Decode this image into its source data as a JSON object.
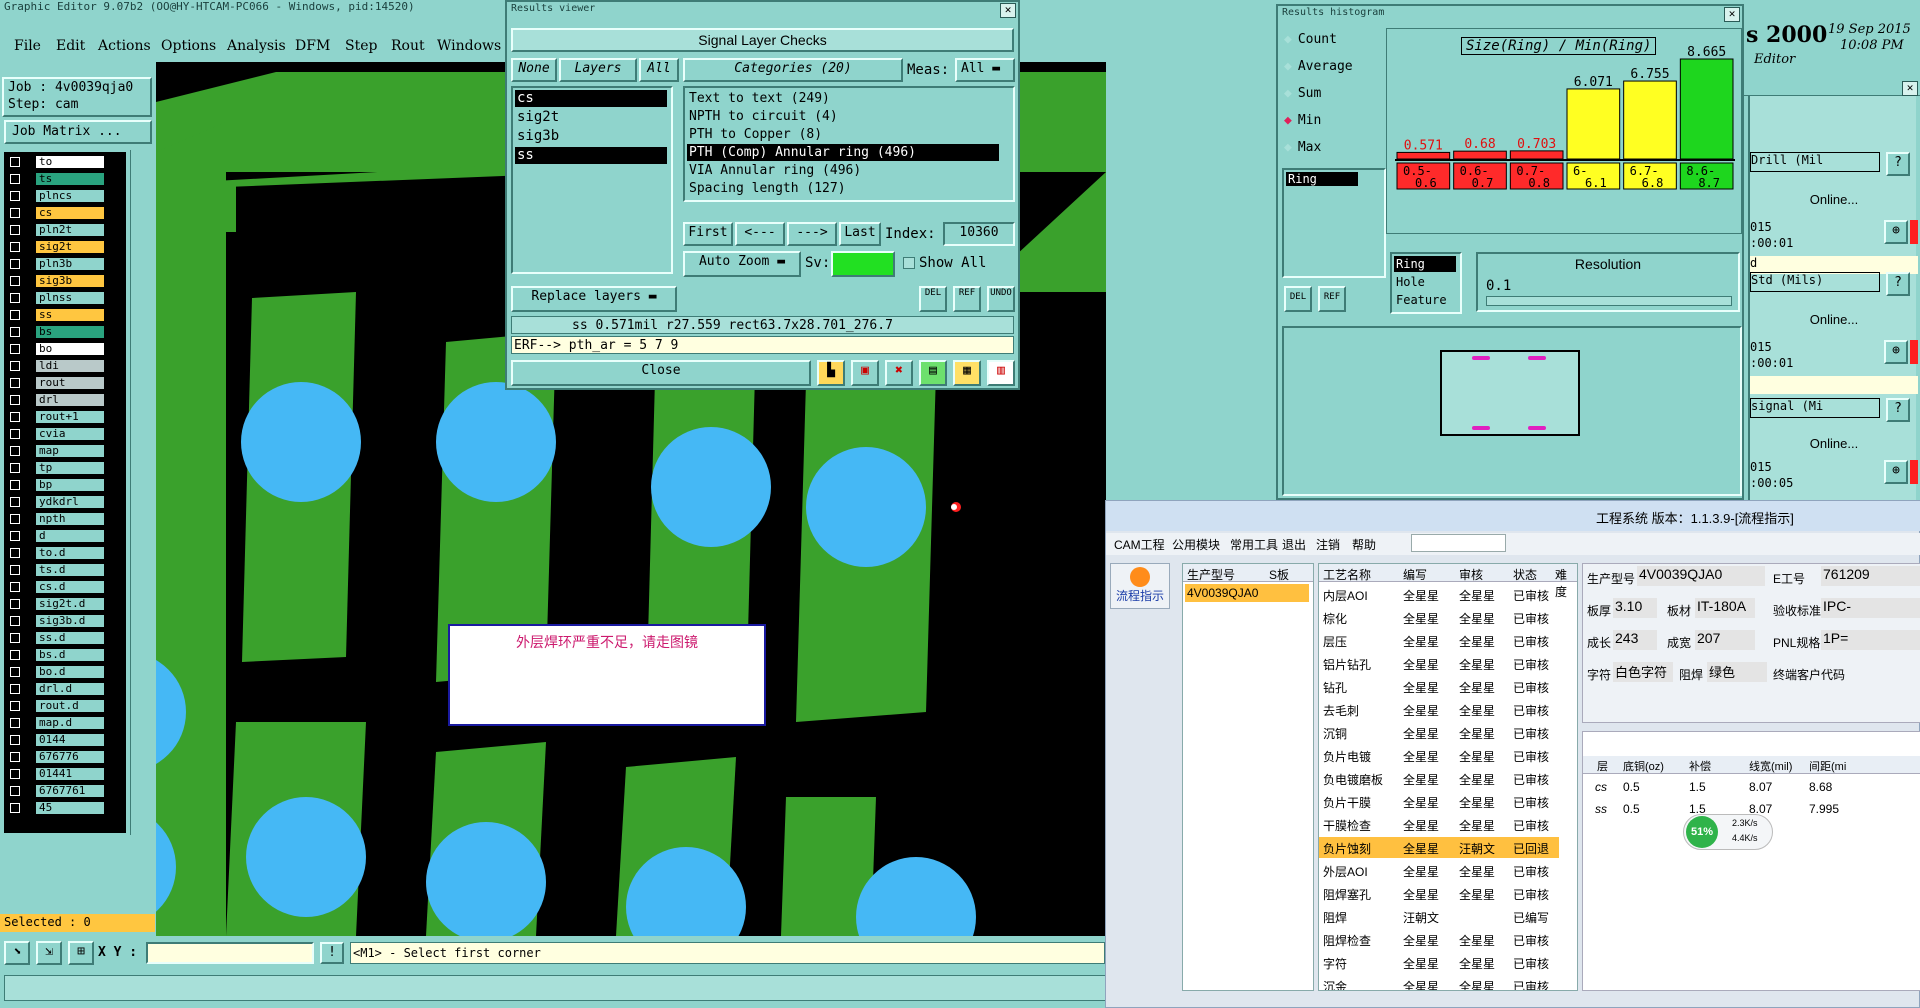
{
  "main_window": {
    "title": "Graphic Editor 9.07b2 (OO@HY-HTCAM-PC066 - Windows, pid:14520)",
    "menu": [
      "File",
      "Edit",
      "Actions",
      "Options",
      "Analysis",
      "DFM",
      "Step",
      "Rout",
      "Windows"
    ],
    "job_label": "Job : 4v0039qja0",
    "step_label": "Step: cam",
    "job_matrix": "Job Matrix ...",
    "layers": [
      {
        "name": "to",
        "color": "#ffffff"
      },
      {
        "name": "ts",
        "color": "#2aa37f"
      },
      {
        "name": "plncs",
        "color": "#8fd4cc"
      },
      {
        "name": "cs",
        "color": "#ffc640"
      },
      {
        "name": "pln2t",
        "color": "#8fd4cc"
      },
      {
        "name": "sig2t",
        "color": "#ffc640"
      },
      {
        "name": "pln3b",
        "color": "#8fd4cc"
      },
      {
        "name": "sig3b",
        "color": "#ffc640"
      },
      {
        "name": "plnss",
        "color": "#8fd4cc"
      },
      {
        "name": "ss",
        "color": "#ffc640"
      },
      {
        "name": "bs",
        "color": "#2aa37f"
      },
      {
        "name": "bo",
        "color": "#ffffff"
      },
      {
        "name": "ldi",
        "color": "#b9c9c9"
      },
      {
        "name": "rout",
        "color": "#b9c9c9"
      },
      {
        "name": "drl",
        "color": "#b9c9c9"
      },
      {
        "name": "rout+1",
        "color": "#8fd4cc"
      },
      {
        "name": "cvia",
        "color": "#8fd4cc"
      },
      {
        "name": "map",
        "color": "#8fd4cc"
      },
      {
        "name": "tp",
        "color": "#8fd4cc"
      },
      {
        "name": "bp",
        "color": "#8fd4cc"
      },
      {
        "name": "ydkdrl",
        "color": "#8fd4cc"
      },
      {
        "name": "npth",
        "color": "#8fd4cc"
      },
      {
        "name": "d",
        "color": "#8fd4cc"
      },
      {
        "name": "to.d",
        "color": "#8fd4cc"
      },
      {
        "name": "ts.d",
        "color": "#8fd4cc"
      },
      {
        "name": "cs.d",
        "color": "#8fd4cc"
      },
      {
        "name": "sig2t.d",
        "color": "#8fd4cc"
      },
      {
        "name": "sig3b.d",
        "color": "#8fd4cc"
      },
      {
        "name": "ss.d",
        "color": "#8fd4cc"
      },
      {
        "name": "bs.d",
        "color": "#8fd4cc"
      },
      {
        "name": "bo.d",
        "color": "#8fd4cc"
      },
      {
        "name": "drl.d",
        "color": "#8fd4cc"
      },
      {
        "name": "rout.d",
        "color": "#8fd4cc"
      },
      {
        "name": "map.d",
        "color": "#8fd4cc"
      },
      {
        "name": "0144",
        "color": "#8fd4cc"
      },
      {
        "name": "676776",
        "color": "#8fd4cc"
      },
      {
        "name": "01441",
        "color": "#8fd4cc"
      },
      {
        "name": "6767761",
        "color": "#8fd4cc"
      },
      {
        "name": "45",
        "color": "#8fd4cc"
      }
    ],
    "selected": "Selected : 0",
    "xy_label": "X Y :",
    "prompt": "<M1> - Select first corner",
    "warning": "外层焊环严重不足，请走图镜"
  },
  "results_viewer": {
    "title": "Results viewer",
    "header": "Signal Layer Checks",
    "none": "None",
    "layers_tab": "Layers",
    "all_tab": "All",
    "categories": "Categories (20)",
    "meas_label": "Meas:",
    "meas_value": "All",
    "layer_list": [
      "cs",
      "sig2t",
      "sig3b",
      "ss"
    ],
    "category_list": [
      "Text to text (249)",
      "NPTH to circuit (4)",
      "PTH to Copper (8)",
      "PTH (Comp) Annular ring (496)",
      "VIA Annular ring (496)",
      "Spacing length (127)"
    ],
    "first": "First",
    "prev": "<---",
    "next": "--->",
    "last": "Last",
    "index_label": "Index:",
    "index_value": "10360",
    "auto_zoom": "Auto Zoom",
    "sv_label": "Sv:",
    "show_all": "Show All",
    "replace_layers": "Replace layers",
    "status": "ss 0.571mil   r27.559   rect63.7x28.701_276.7",
    "erf": "ERF--> pth_ar = 5 7 9",
    "close": "Close",
    "small_btns": [
      "DEL",
      "REF",
      "UNDO"
    ]
  },
  "histogram": {
    "title": "Results histogram",
    "options": [
      "Count",
      "Average",
      "Sum",
      "Min",
      "Max"
    ],
    "selected_option": "Min",
    "heading": "Size(Ring) / Min(Ring)",
    "ring_label": "Ring",
    "types": [
      "Ring",
      "Hole",
      "Feature"
    ],
    "resolution_label": "Resolution",
    "resolution_value": "0.1",
    "btns": [
      "DEL",
      "REF"
    ]
  },
  "chart_data": {
    "type": "bar",
    "title": "Size(Ring) / Min(Ring)",
    "categories": [
      "0.5-0.6",
      "0.6-0.7",
      "0.7-0.8",
      "6-6.1",
      "6.7-6.8",
      "8.6-8.7"
    ],
    "values": [
      0.571,
      0.68,
      0.703,
      6.071,
      6.755,
      8.665
    ],
    "colors": [
      "#ff2a2a",
      "#ff2a2a",
      "#ff2a2a",
      "#ffff22",
      "#ffff22",
      "#1ed61e"
    ],
    "ylim": [
      0,
      8.665
    ],
    "xlabel": "",
    "ylabel": ""
  },
  "right_panel": {
    "title_tail": "s 2000",
    "date": "19 Sep 2015",
    "time": "10:08 PM",
    "editor": "Editor",
    "drill": "Drill (Mil",
    "std": "Std (Mils)",
    "signal": "signal (Mi",
    "online": "Online...",
    "help": "?",
    "t1a": "015",
    "t1b": ":00:01",
    "t2a": "015",
    "t2b": ":00:01",
    "t3a": "015",
    "t3b": ":00:05",
    "d": "d"
  },
  "cam": {
    "title": "工程系统 版本：1.1.3.9-[流程指示]",
    "menu": [
      "CAM工程",
      "公用模块",
      "常用工具",
      "退出",
      "注销",
      "帮助"
    ],
    "flow_btn": "流程指示",
    "model_headers": [
      "生产型号",
      "S板"
    ],
    "model_value": "4V0039QJA0",
    "proc_headers": [
      "工艺名称",
      "编写",
      "审核",
      "状态",
      "难度"
    ],
    "processes": [
      [
        "内层AOI",
        "全星星",
        "全星星",
        "已审核"
      ],
      [
        "棕化",
        "全星星",
        "全星星",
        "已审核"
      ],
      [
        "层压",
        "全星星",
        "全星星",
        "已审核"
      ],
      [
        "铝片钻孔",
        "全星星",
        "全星星",
        "已审核"
      ],
      [
        "钻孔",
        "全星星",
        "全星星",
        "已审核"
      ],
      [
        "去毛刺",
        "全星星",
        "全星星",
        "已审核"
      ],
      [
        "沉铜",
        "全星星",
        "全星星",
        "已审核"
      ],
      [
        "负片电镀",
        "全星星",
        "全星星",
        "已审核"
      ],
      [
        "负电镀磨板",
        "全星星",
        "全星星",
        "已审核"
      ],
      [
        "负片干膜",
        "全星星",
        "全星星",
        "已审核"
      ],
      [
        "干膜检查",
        "全星星",
        "全星星",
        "已审核"
      ],
      [
        "负片蚀刻",
        "全星星",
        "汪朝文",
        "已回退"
      ],
      [
        "外层AOI",
        "全星星",
        "全星星",
        "已审核"
      ],
      [
        "阻焊塞孔",
        "全星星",
        "全星星",
        "已审核"
      ],
      [
        "阻焊",
        "汪朝文",
        "",
        "已编写"
      ],
      [
        "阻焊检查",
        "全星星",
        "全星星",
        "已审核"
      ],
      [
        "字符",
        "全星星",
        "全星星",
        "已审核"
      ],
      [
        "沉金",
        "全星星",
        "全星星",
        "已审核"
      ]
    ],
    "info": {
      "prod_label": "生产型号",
      "prod_value": "4V0039QJA0",
      "e_label": "E工号",
      "e_value": "761209",
      "thick_label": "板厚",
      "thick_value": "3.10",
      "mat_label": "板材",
      "mat_value": "IT-180A",
      "std_label": "验收标准",
      "std_value": "IPC-",
      "len_label": "成长",
      "len_value": "243",
      "wid_label": "成宽",
      "wid_value": "207",
      "pnl_label": "PNL规格",
      "pnl_value": "1P=",
      "char_label": "字符",
      "char_value": "白色字符",
      "mask_label": "阻焊",
      "mask_value": "绿色",
      "cust_label": "终端客户代码"
    },
    "layer_headers": [
      "层",
      "底铜(oz)",
      "补偿",
      "线宽(mil)",
      "间距(mi"
    ],
    "layer_rows": [
      [
        "cs",
        "0.5",
        "1.5",
        "8.07",
        "8.68"
      ],
      [
        "ss",
        "0.5",
        "1.5",
        "8.07",
        "7.995"
      ]
    ],
    "net": {
      "pct": "51%",
      "up": "2.3K/s",
      "down": "4.4K/s"
    }
  }
}
